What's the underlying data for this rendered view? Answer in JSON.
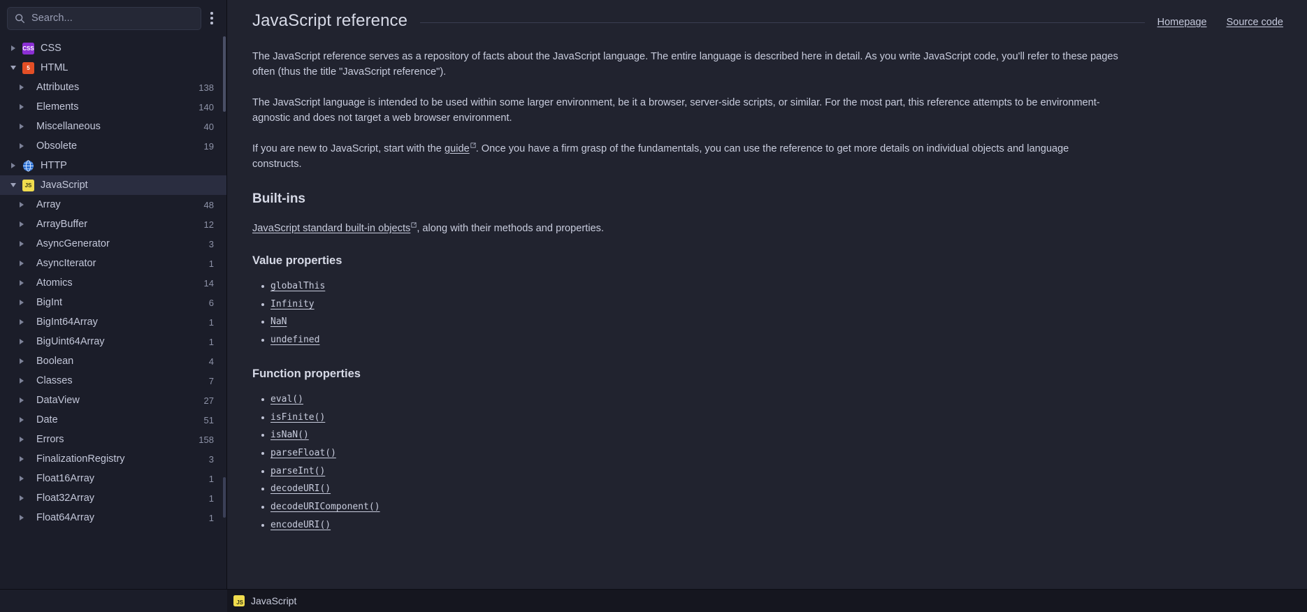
{
  "search": {
    "placeholder": "Search...",
    "icon": "search-icon",
    "menu_icon": "kebab-menu-icon"
  },
  "sidebar": {
    "docsets": [
      {
        "label": "CSS",
        "icon": "css-icon",
        "expanded": false,
        "level": 1,
        "count": ""
      },
      {
        "label": "HTML",
        "icon": "html5-icon",
        "expanded": true,
        "level": 1,
        "count": ""
      },
      {
        "label": "Attributes",
        "icon": "",
        "expanded": false,
        "level": 2,
        "count": "138"
      },
      {
        "label": "Elements",
        "icon": "",
        "expanded": false,
        "level": 2,
        "count": "140"
      },
      {
        "label": "Miscellaneous",
        "icon": "",
        "expanded": false,
        "level": 2,
        "count": "40"
      },
      {
        "label": "Obsolete",
        "icon": "",
        "expanded": false,
        "level": 2,
        "count": "19"
      },
      {
        "label": "HTTP",
        "icon": "http-icon",
        "expanded": false,
        "level": 1,
        "count": ""
      },
      {
        "label": "JavaScript",
        "icon": "js-icon",
        "expanded": true,
        "level": 1,
        "count": "",
        "selected": true
      },
      {
        "label": "Array",
        "icon": "",
        "expanded": false,
        "level": 2,
        "count": "48"
      },
      {
        "label": "ArrayBuffer",
        "icon": "",
        "expanded": false,
        "level": 2,
        "count": "12"
      },
      {
        "label": "AsyncGenerator",
        "icon": "",
        "expanded": false,
        "level": 2,
        "count": "3"
      },
      {
        "label": "AsyncIterator",
        "icon": "",
        "expanded": false,
        "level": 2,
        "count": "1"
      },
      {
        "label": "Atomics",
        "icon": "",
        "expanded": false,
        "level": 2,
        "count": "14"
      },
      {
        "label": "BigInt",
        "icon": "",
        "expanded": false,
        "level": 2,
        "count": "6"
      },
      {
        "label": "BigInt64Array",
        "icon": "",
        "expanded": false,
        "level": 2,
        "count": "1"
      },
      {
        "label": "BigUint64Array",
        "icon": "",
        "expanded": false,
        "level": 2,
        "count": "1"
      },
      {
        "label": "Boolean",
        "icon": "",
        "expanded": false,
        "level": 2,
        "count": "4"
      },
      {
        "label": "Classes",
        "icon": "",
        "expanded": false,
        "level": 2,
        "count": "7"
      },
      {
        "label": "DataView",
        "icon": "",
        "expanded": false,
        "level": 2,
        "count": "27"
      },
      {
        "label": "Date",
        "icon": "",
        "expanded": false,
        "level": 2,
        "count": "51"
      },
      {
        "label": "Errors",
        "icon": "",
        "expanded": false,
        "level": 2,
        "count": "158"
      },
      {
        "label": "FinalizationRegistry",
        "icon": "",
        "expanded": false,
        "level": 2,
        "count": "3"
      },
      {
        "label": "Float16Array",
        "icon": "",
        "expanded": false,
        "level": 2,
        "count": "1"
      },
      {
        "label": "Float32Array",
        "icon": "",
        "expanded": false,
        "level": 2,
        "count": "1"
      },
      {
        "label": "Float64Array",
        "icon": "",
        "expanded": false,
        "level": 2,
        "count": "1"
      }
    ]
  },
  "page": {
    "title": "JavaScript reference",
    "links": [
      {
        "label": "Homepage"
      },
      {
        "label": "Source code"
      }
    ],
    "paragraphs": [
      {
        "text": "The JavaScript reference serves as a repository of facts about the JavaScript language. The entire language is described here in detail. As you write JavaScript code, you'll refer to these pages often (thus the title \"JavaScript reference\")."
      },
      {
        "text": "The JavaScript language is intended to be used within some larger environment, be it a browser, server-side scripts, or similar. For the most part, this reference attempts to be environment-agnostic and does not target a web browser environment."
      }
    ],
    "guide_para": {
      "before": "If you are new to JavaScript, start with the ",
      "link": "guide",
      "after": ". Once you have a firm grasp of the fundamentals, you can use the reference to get more details on individual objects and language constructs."
    },
    "builtins": {
      "heading": "Built-ins",
      "link": "JavaScript standard built-in objects",
      "after": ", along with their methods and properties."
    },
    "value_properties": {
      "heading": "Value properties",
      "items": [
        "globalThis",
        "Infinity",
        "NaN",
        "undefined"
      ]
    },
    "function_properties": {
      "heading": "Function properties",
      "items": [
        "eval()",
        "isFinite()",
        "isNaN()",
        "parseFloat()",
        "parseInt()",
        "decodeURI()",
        "decodeURIComponent()",
        "encodeURI()"
      ]
    }
  },
  "statusbar": {
    "label": "JavaScript",
    "icon": "js-icon"
  },
  "colors": {
    "sidebar_bg": "#1b1d29",
    "content_bg": "#21232f",
    "selected_row": "#2a2d40",
    "text": "#c8ccdd",
    "js_yellow": "#f0dc4e",
    "html_orange": "#e34f26",
    "css_purple": "#8b2fd4",
    "statusbar_bg": "#15161f"
  }
}
